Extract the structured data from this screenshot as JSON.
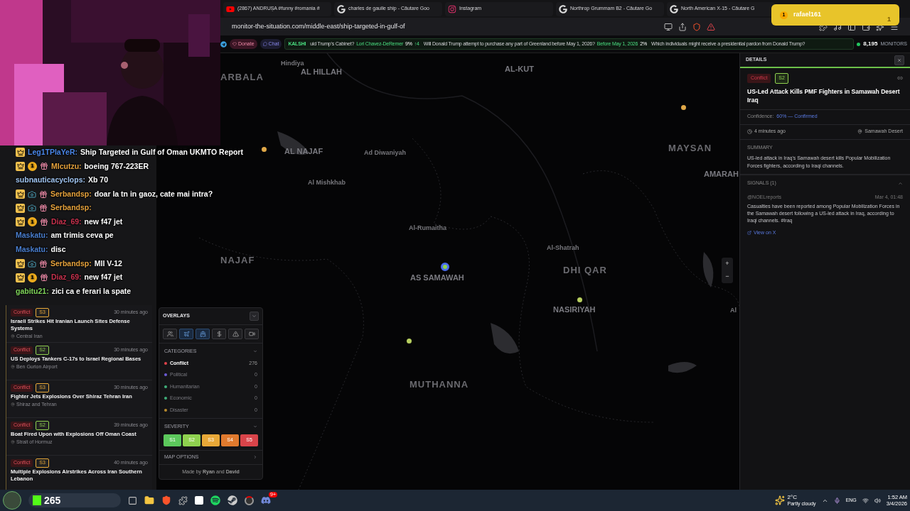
{
  "browser": {
    "tabs": [
      {
        "kind": "youtube",
        "title": "(2867) ANDRUȘA #funny #romania #"
      },
      {
        "kind": "google",
        "title": "charles de gaulle ship - Căutare Goo"
      },
      {
        "kind": "instagram",
        "title": "Instagram"
      },
      {
        "kind": "google",
        "title": "Northrop Grummam B2 - Căutare Go"
      },
      {
        "kind": "google",
        "title": "North American X-15 - Căutare G"
      }
    ],
    "address": "monitor-the-situation.com/middle-east/ship-targeted-in-gulf-of"
  },
  "ticker": {
    "donate": "Donate",
    "chat": "Chat",
    "source": "KALSHI",
    "items": [
      {
        "question": "uid Trump's Cabinet?",
        "answer": "Lori Chavez-DeRemer",
        "percent": "9%",
        "change": "↑4"
      },
      {
        "question": "Will Donald Trump attempt to purchase any part of Greenland before May 1, 2026?",
        "answer": "Before May 1, 2026",
        "percent": "2%"
      },
      {
        "question": "Which individuals might receive a presidential pardon from Donald Trump?"
      }
    ],
    "monitors_count": "8,195",
    "monitors_label": "MONITORS"
  },
  "notification": {
    "user": "rafael161",
    "badge": "1",
    "count": "1"
  },
  "chat": [
    {
      "user": "Leg1TPlaYeR:",
      "color": "#4a86e8",
      "badges": [
        {
          "kind": "crown"
        }
      ],
      "text": "Ship Targeted in Gulf of Oman UKMTO Report"
    },
    {
      "user": "MIcutzu:",
      "color": "#e6a23c",
      "badges": [
        {
          "kind": "crown"
        },
        {
          "kind": "coin",
          "label": "1"
        },
        {
          "kind": "gift"
        }
      ],
      "text": "boeing 767-223ER"
    },
    {
      "user": "subnauticacyclops:",
      "color": "#9fc3f0",
      "text": "Xb 70"
    },
    {
      "user": "Serbandsp:",
      "color": "#e6a23c",
      "badges": [
        {
          "kind": "crown"
        },
        {
          "kind": "camera"
        },
        {
          "kind": "gift"
        }
      ],
      "text": "doar la tn in gaoz, cate mai intra?"
    },
    {
      "user": "Serbandsp:",
      "color": "#e6a23c",
      "badges": [
        {
          "kind": "crown"
        },
        {
          "kind": "camera"
        },
        {
          "kind": "gift"
        }
      ]
    },
    {
      "user": "Diaz_69:",
      "color": "#c8324e",
      "badges": [
        {
          "kind": "crown"
        },
        {
          "kind": "coin",
          "label": "1"
        },
        {
          "kind": "gift"
        }
      ],
      "text": "new f47 jet"
    },
    {
      "user": "Maskatu:",
      "color": "#4a7fd0",
      "text": "am trimis ceva pe"
    },
    {
      "user": "Maskatu:",
      "color": "#4a7fd0",
      "text": "disc"
    },
    {
      "user": "Serbandsp:",
      "color": "#e6a23c",
      "badges": [
        {
          "kind": "crown"
        },
        {
          "kind": "camera"
        },
        {
          "kind": "gift"
        }
      ],
      "text": "MII V-12"
    },
    {
      "user": "Diaz_69:",
      "color": "#c8324e",
      "badges": [
        {
          "kind": "crown"
        },
        {
          "kind": "coin",
          "label": "1"
        },
        {
          "kind": "gift"
        }
      ],
      "text": "new f47 jet"
    },
    {
      "user": "gabitu21:",
      "color": "#7fd45a",
      "text": "zici ca e ferari la spate"
    }
  ],
  "feed": [
    {
      "category": "Conflict",
      "severity": "S3",
      "color": "#e8a838",
      "time": "30 minutes ago",
      "title": "Israeli Strikes Hit Iranian Launch Sites Defense Systems",
      "location": "Central Iran"
    },
    {
      "category": "Conflict",
      "severity": "S2",
      "color": "#8fd14f",
      "time": "30 minutes ago",
      "title": "US Deploys Tankers C-17s to Israel Regional Bases",
      "location": "Ben Gurion Airport"
    },
    {
      "category": "Conflict",
      "severity": "S3",
      "color": "#e8a838",
      "time": "30 minutes ago",
      "title": "Fighter Jets Explosions Over Shiraz Tehran Iran",
      "location": "Shiraz and Tehran"
    },
    {
      "category": "Conflict",
      "severity": "S2",
      "color": "#8fd14f",
      "time": "39 minutes ago",
      "title": "Boat Fired Upon with Explosions Off Oman Coast",
      "location": "Strait of Hormuz"
    },
    {
      "category": "Conflict",
      "severity": "S3",
      "color": "#e8a838",
      "time": "40 minutes ago",
      "title": "Multiple Explosions Airstrikes Across Iran Southern Lebanon"
    }
  ],
  "overlays": {
    "title": "OVERLAYS",
    "buttons": [
      {
        "kind": "people",
        "selected": false
      },
      {
        "kind": "aircraft",
        "selected": true
      },
      {
        "kind": "vessel",
        "selected": true
      },
      {
        "kind": "finance",
        "selected": false
      },
      {
        "kind": "alert",
        "selected": false
      },
      {
        "kind": "camera",
        "selected": false
      }
    ],
    "categories_title": "CATEGORIES",
    "categories": [
      {
        "name": "Conflict",
        "count": "276",
        "color": "#e0434b",
        "disabled": false
      },
      {
        "name": "Political",
        "count": "0",
        "color": "#6b5bd6",
        "disabled": true
      },
      {
        "name": "Humanitarian",
        "count": "0",
        "color": "#3fae7a",
        "disabled": true
      },
      {
        "name": "Economic",
        "count": "0",
        "color": "#3fae7a",
        "disabled": true
      },
      {
        "name": "Disaster",
        "count": "0",
        "color": "#b88a2e",
        "disabled": true
      }
    ],
    "severity_title": "SEVERITY",
    "severities": [
      {
        "label": "S1",
        "color": "#5cc85c"
      },
      {
        "label": "S2",
        "color": "#8fd14f"
      },
      {
        "label": "S3",
        "color": "#e8a838"
      },
      {
        "label": "S4",
        "color": "#e07a2e"
      },
      {
        "label": "S5",
        "color": "#d9444a"
      }
    ],
    "map_options": "MAP OPTIONS",
    "credit": "Made by **Ryan** and **David**"
  },
  "map": {
    "labels": [
      {
        "text": "Hindiya",
        "kind": "town"
      },
      {
        "text": "AL HILLAH",
        "kind": "city"
      },
      {
        "text": "ARBALA",
        "kind": "region"
      },
      {
        "text": "AL-KUT",
        "kind": "city"
      },
      {
        "text": "AL NAJAF",
        "kind": "city"
      },
      {
        "text": "Ad Diwaniyah",
        "kind": "town"
      },
      {
        "text": "Al Mishkhab",
        "kind": "town"
      },
      {
        "text": "MAYSAN",
        "kind": "region"
      },
      {
        "text": "AMARAH",
        "kind": "city"
      },
      {
        "text": "Al-Rumaitha",
        "kind": "town"
      },
      {
        "text": "NAJAF",
        "kind": "region"
      },
      {
        "text": "AS SAMAWAH",
        "kind": "city"
      },
      {
        "text": "Al-Shatrah",
        "kind": "town"
      },
      {
        "text": "DHI QAR",
        "kind": "region"
      },
      {
        "text": "NASIRIYAH",
        "kind": "city"
      },
      {
        "text": "MUTHANNA",
        "kind": "region"
      },
      {
        "text": "Al",
        "kind": "town"
      }
    ],
    "markers": [
      {
        "color": "#e0a848",
        "selected": false
      },
      {
        "color": "#e0a848",
        "selected": false
      },
      {
        "color": "#8fd14f",
        "selected": true
      },
      {
        "color": "#b8d060",
        "selected": false
      },
      {
        "color": "#b8d060",
        "selected": false
      }
    ],
    "zoom_in": "+",
    "zoom_out": "−"
  },
  "details": {
    "title": "DETAILS",
    "category": "Conflict",
    "severity": {
      "label": "S2",
      "color": "#8fd14f"
    },
    "headline": "US-Led Attack Kills PMF Fighters in Samawah Desert Iraq",
    "confidence_label": "Confidence:",
    "confidence": "60% — Confirmed",
    "time": "4 minutes ago",
    "location": "Samawah Desert",
    "summary_title": "SUMMARY",
    "summary": "US-led attack in Iraq's Samawah desert kills Popular Mobilization Forces fighters, according to Iraqi channels.",
    "signals_title": "SIGNALS (1)",
    "signals_expanded": true,
    "signals": [
      {
        "source": "@NOELreports",
        "date": "Mar 4, 01:48",
        "text": "Casualties have been reported among Popular Mobilization Forces in the Samawah desert following a US-led attack in Iraq, according to Iraqi channels. #Iraq",
        "link": "View on X"
      }
    ]
  },
  "taskbar": {
    "viewers": "265",
    "weather_temp": "2°C",
    "weather_text": "Partly cloudy",
    "language": "ENG",
    "time": "1:52 AM",
    "date": "3/4/2026",
    "discord_badge": "9+"
  }
}
